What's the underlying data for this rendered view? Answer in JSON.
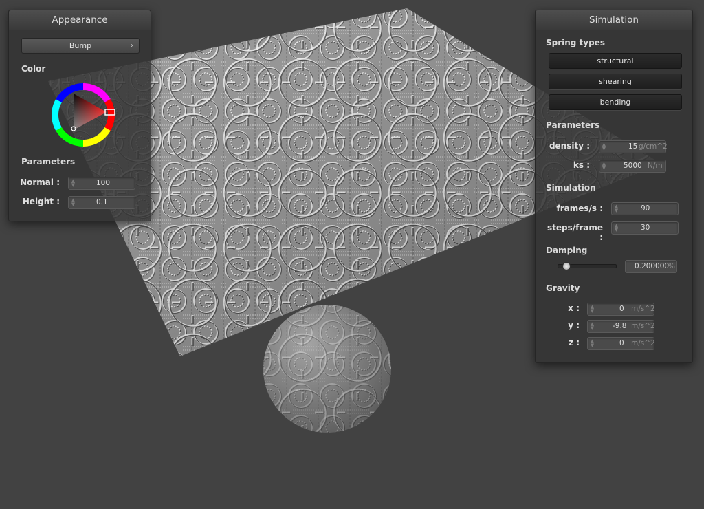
{
  "appearance": {
    "title": "Appearance",
    "shader_select": "Bump",
    "color_label": "Color",
    "parameters_label": "Parameters",
    "normal_label": "Normal :",
    "normal_value": "100",
    "height_label": "Height :",
    "height_value": "0.1",
    "selected_color": "#ff0000"
  },
  "simulation": {
    "title": "Simulation",
    "spring_types_label": "Spring types",
    "spring_buttons": [
      "structural",
      "shearing",
      "bending"
    ],
    "parameters_label": "Parameters",
    "density_label": "density :",
    "density_value": "15",
    "density_unit": "g/cm^2",
    "ks_label": "ks :",
    "ks_value": "5000",
    "ks_unit": "N/m",
    "simulation_label": "Simulation",
    "fps_label": "frames/s :",
    "fps_value": "90",
    "steps_label": "steps/frame :",
    "steps_value": "30",
    "damping_label": "Damping",
    "damping_value": "0.200000",
    "damping_unit": "%",
    "damping_fraction": 0.2,
    "gravity_label": "Gravity",
    "gx_label": "x :",
    "gx_value": "0",
    "gy_label": "y :",
    "gy_value": "-9.8",
    "gz_label": "z :",
    "gz_value": "0",
    "gravity_unit": "m/s^2"
  }
}
